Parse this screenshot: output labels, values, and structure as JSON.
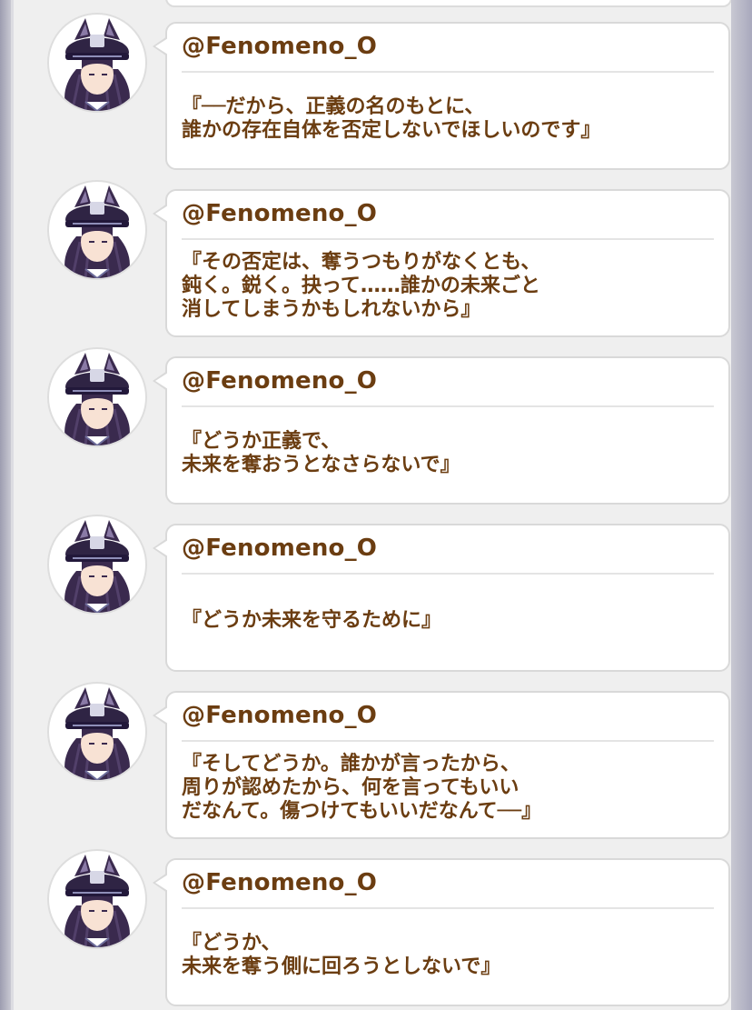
{
  "colors": {
    "text": "#6b3d11",
    "card_background": "#ffffff",
    "feed_background": "#efefef"
  },
  "posts": [
    {
      "avatar": "fenomeno-avatar-icon",
      "username": "@Fenomeno_O",
      "lines": [
        "『──だから、正義の名のもとに、",
        "誰かの存在自体を否定しないでほしいのです』"
      ]
    },
    {
      "avatar": "fenomeno-avatar-icon",
      "username": "@Fenomeno_O",
      "lines": [
        "『その否定は、奪うつもりがなくとも、",
        "鈍く。鋭く。抉って……誰かの未来ごと",
        "消してしまうかもしれないから』"
      ]
    },
    {
      "avatar": "fenomeno-avatar-icon",
      "username": "@Fenomeno_O",
      "lines": [
        "『どうか正義で、",
        "未来を奪おうとなさらないで』"
      ]
    },
    {
      "avatar": "fenomeno-avatar-icon",
      "username": "@Fenomeno_O",
      "lines": [
        "『どうか未来を守るために』"
      ]
    },
    {
      "avatar": "fenomeno-avatar-icon",
      "username": "@Fenomeno_O",
      "lines": [
        "『そしてどうか。誰かが言ったから、",
        "周りが認めたから、何を言ってもいい",
        "だなんて。傷つけてもいいだなんて──』"
      ]
    },
    {
      "avatar": "fenomeno-avatar-icon",
      "username": "@Fenomeno_O",
      "lines": [
        "『どうか、",
        "未来を奪う側に回ろうとしないで』"
      ]
    }
  ]
}
